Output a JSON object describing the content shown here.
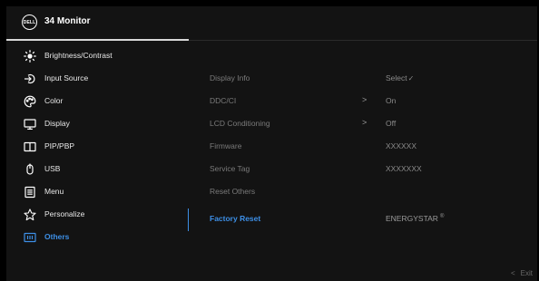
{
  "header": {
    "logo_text": "DELL",
    "title": "34 Monitor"
  },
  "nav": {
    "items": [
      {
        "label": "Brightness/Contrast",
        "icon": "brightness-icon"
      },
      {
        "label": "Input Source",
        "icon": "input-source-icon"
      },
      {
        "label": "Color",
        "icon": "color-icon"
      },
      {
        "label": "Display",
        "icon": "display-icon"
      },
      {
        "label": "PIP/PBP",
        "icon": "pip-pbp-icon"
      },
      {
        "label": "USB",
        "icon": "usb-icon"
      },
      {
        "label": "Menu",
        "icon": "menu-icon"
      },
      {
        "label": "Personalize",
        "icon": "star-icon"
      },
      {
        "label": "Others",
        "icon": "others-icon",
        "active": true
      }
    ]
  },
  "settings": {
    "rows": [
      {
        "label": "Display Info",
        "value": "Select",
        "value_suffix": "✓",
        "chevron": ""
      },
      {
        "label": "DDC/CI",
        "value": "On",
        "chevron": ">"
      },
      {
        "label": "LCD Conditioning",
        "value": "Off",
        "chevron": ">"
      },
      {
        "label": "Firmware",
        "value": "XXXXXX",
        "chevron": ""
      },
      {
        "label": "Service Tag",
        "value": "XXXXXXX",
        "chevron": ""
      },
      {
        "label": "Reset Others",
        "value": "",
        "chevron": ""
      },
      {
        "label": "Factory Reset",
        "value": "ENERGYSTAR",
        "value_suffix": "®",
        "chevron": "",
        "active": true
      }
    ]
  },
  "footer": {
    "exit_chevron": "<",
    "exit_label": "Exit"
  },
  "colors": {
    "accent": "#3d8fe6",
    "panel_bg": "#131313"
  }
}
